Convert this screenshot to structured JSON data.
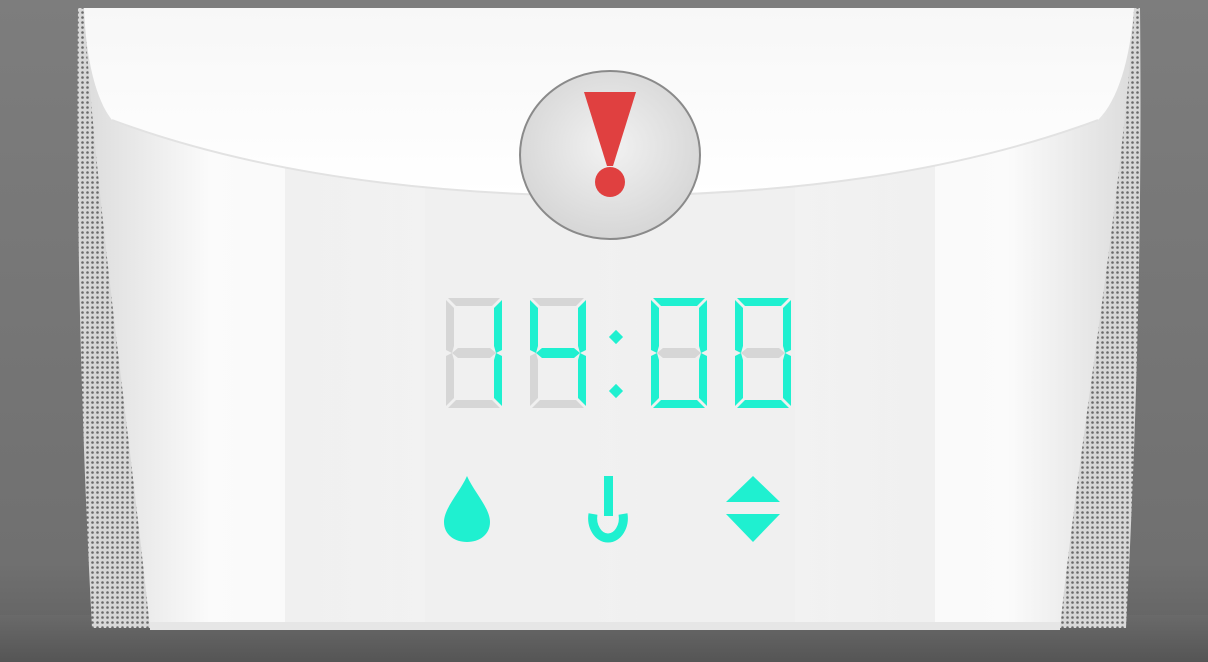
{
  "display": {
    "time_text": "14:00",
    "digits": [
      "1",
      "4",
      "0",
      "0"
    ],
    "unlit_template": "88:88"
  },
  "colors": {
    "lit_segment": "#1ff0d0",
    "unlit_segment": "#d6d6d6",
    "alert": "#e04040",
    "body": "#f2f2f2"
  },
  "controls": {
    "alert_icon": "exclamation-icon",
    "water_icon": "water-drop-icon",
    "power_icon": "power-icon",
    "adjust_icon": "up-down-arrows-icon"
  }
}
